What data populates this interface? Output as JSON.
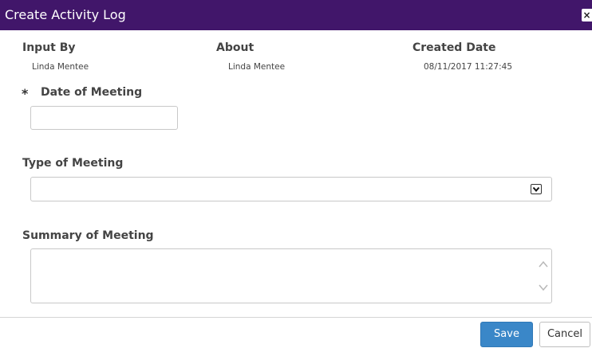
{
  "dialog": {
    "title": "Create Activity Log",
    "close_label": "×"
  },
  "meta": {
    "input_by": {
      "label": "Input By",
      "value": "Linda Mentee"
    },
    "about": {
      "label": "About",
      "value": "Linda Mentee"
    },
    "created_date": {
      "label": "Created Date",
      "value": "08/11/2017 11:27:45"
    }
  },
  "form": {
    "date_of_meeting": {
      "required_marker": "*",
      "label": "Date of Meeting",
      "value": ""
    },
    "type_of_meeting": {
      "label": "Type of Meeting",
      "selected": ""
    },
    "summary_of_meeting": {
      "label": "Summary of Meeting",
      "value": ""
    }
  },
  "footer": {
    "save_label": "Save",
    "cancel_label": "Cancel"
  },
  "colors": {
    "titlebar": "#41166a",
    "primary_button": "#3a87c8"
  },
  "icons": {
    "close": "close-icon",
    "select_arrow": "chevron-down-icon",
    "scroll_up": "chevron-up-icon",
    "scroll_down": "chevron-down-icon"
  }
}
